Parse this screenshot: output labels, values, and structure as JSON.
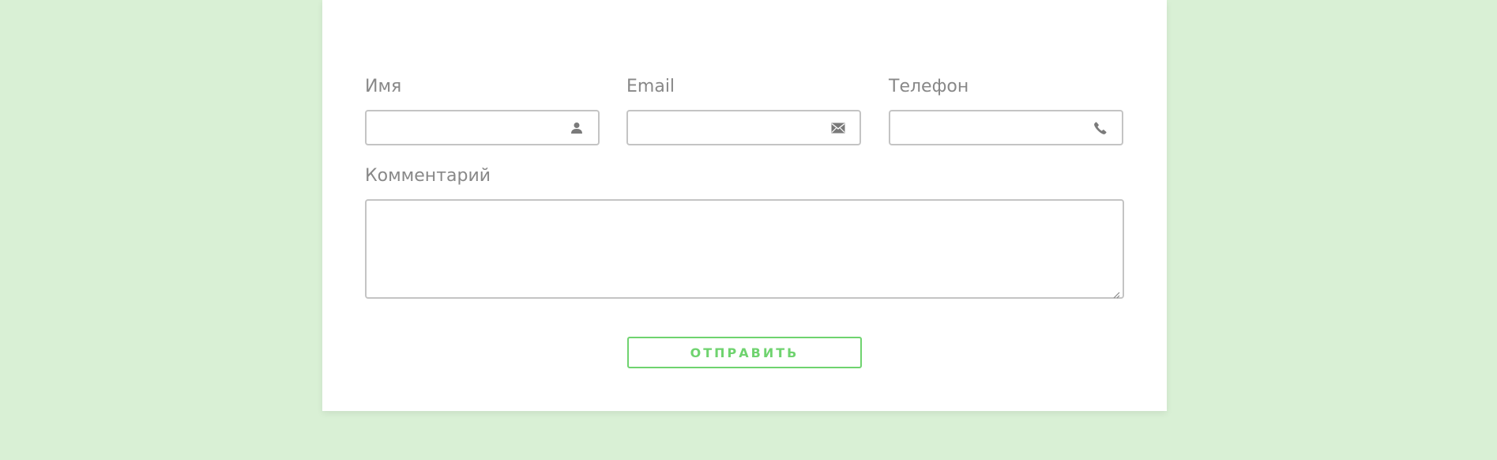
{
  "form": {
    "name": {
      "label": "Имя",
      "value": "",
      "placeholder": "",
      "icon": "user-icon"
    },
    "email": {
      "label": "Email",
      "value": "",
      "placeholder": "",
      "icon": "envelope-icon"
    },
    "phone": {
      "label": "Телефон",
      "value": "",
      "placeholder": "",
      "icon": "phone-icon"
    },
    "comment": {
      "label": "Комментарий",
      "value": "",
      "placeholder": ""
    },
    "submit_label": "ОТПРАВИТЬ"
  },
  "colors": {
    "page_background": "#d9f0d5",
    "card_background": "#ffffff",
    "label_text": "#888888",
    "input_border": "#c4c4c4",
    "accent_green": "#6fd36f",
    "icon_gray": "#7a7a7a"
  }
}
